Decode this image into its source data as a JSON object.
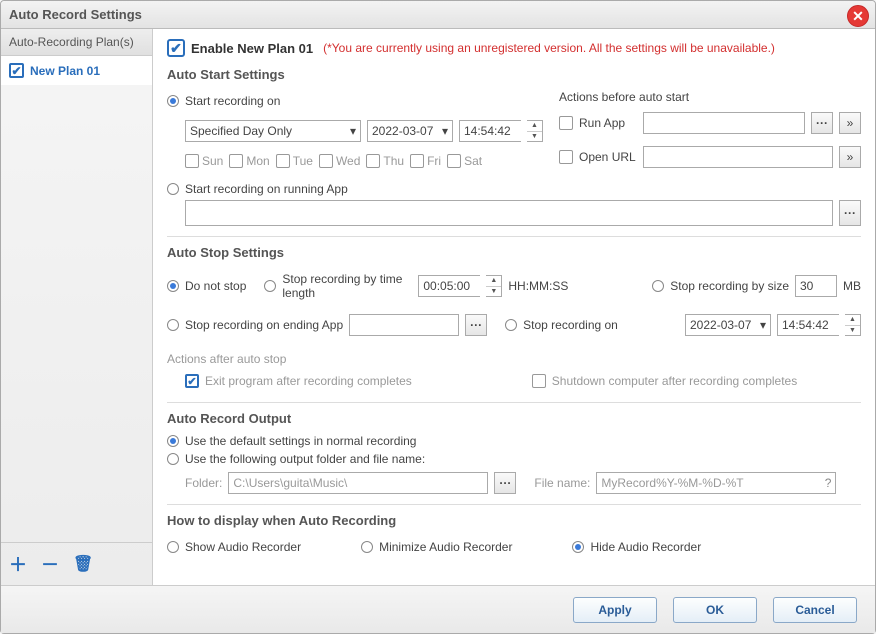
{
  "window": {
    "title": "Auto Record Settings"
  },
  "sidebar": {
    "header": "Auto-Recording Plan(s)",
    "items": [
      {
        "label": "New Plan 01",
        "checked": true
      }
    ]
  },
  "enable": {
    "label": "Enable New Plan 01",
    "notice": "(*You are currently using an unregistered version. All the settings will be unavailable.)"
  },
  "sections": {
    "start": "Auto Start Settings",
    "stop": "Auto Stop Settings",
    "after": "Actions after auto stop",
    "output": "Auto Record Output",
    "display": "How to display when Auto Recording"
  },
  "start": {
    "on_label": "Start recording on",
    "mode": "Specified Day Only",
    "date": "2022-03-07",
    "time": "14:54:42",
    "days": [
      "Sun",
      "Mon",
      "Tue",
      "Wed",
      "Thu",
      "Fri",
      "Sat"
    ],
    "on_app_label": "Start recording on running App",
    "actions_label": "Actions before auto start",
    "run_app": "Run App",
    "open_url": "Open URL"
  },
  "stop": {
    "do_not": "Do not stop",
    "by_time": "Stop recording by time length",
    "time_val": "00:05:00",
    "hhmmss": "HH:MM:SS",
    "by_size": "Stop recording by size",
    "size_val": "30",
    "mb": "MB",
    "on_app": "Stop recording on ending App",
    "on_date": "Stop recording on",
    "date": "2022-03-07",
    "time": "14:54:42"
  },
  "after": {
    "exit": "Exit program after recording completes",
    "shutdown": "Shutdown computer after recording completes"
  },
  "output": {
    "default": "Use the default settings in normal recording",
    "custom": "Use the following output folder and file name:",
    "folder_label": "Folder:",
    "folder": "C:\\Users\\guita\\Music\\",
    "file_label": "File name:",
    "file": "MyRecord%Y-%M-%D-%T"
  },
  "display": {
    "show": "Show Audio Recorder",
    "min": "Minimize Audio Recorder",
    "hide": "Hide Audio Recorder"
  },
  "footer": {
    "apply": "Apply",
    "ok": "OK",
    "cancel": "Cancel"
  }
}
